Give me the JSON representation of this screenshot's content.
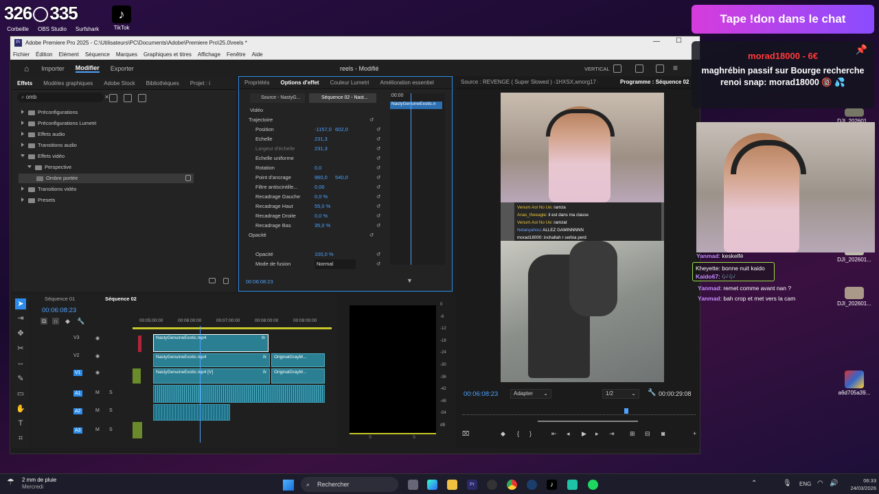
{
  "desktop": {
    "icons": [
      {
        "label": "Corbeille",
        "title_text": "326"
      },
      {
        "label": "OBS Studio",
        "title_text": "335"
      },
      {
        "label": "Surfshark",
        "title_text": ""
      },
      {
        "label": "TikTok",
        "title_text": ""
      }
    ],
    "right_icons": [
      {
        "label": "DJI_202601..."
      },
      {
        "label": "DJI_202601..."
      },
      {
        "label": "DJI_202601..."
      },
      {
        "label": "a6d705a39..."
      }
    ]
  },
  "premiere": {
    "window_title": "Adobe Premiere Pro 2025 - C:\\Utilisateurs\\PC\\Documents\\Adobe\\Premiere Pro\\25.0\\reels *",
    "menu": [
      "Fichier",
      "Édition",
      "Elément",
      "Séquence",
      "Marques",
      "Graphiques et titres",
      "Affichage",
      "Fenêtre",
      "Aide"
    ],
    "workspace_tabs": [
      "Importer",
      "Modifier",
      "Exporter"
    ],
    "active_workspace": "Modifier",
    "project_title": "reels - Modifié",
    "layout_label": "VERTICAL",
    "effects_panel": {
      "tabs": [
        "Effets",
        "Modèles graphiques",
        "Adobe Stock",
        "Bibliothèques",
        "Projet : i"
      ],
      "search_value": "omb",
      "tree": [
        {
          "label": "Préconfigurations",
          "level": 0
        },
        {
          "label": "Préconfigurations Lumetri",
          "level": 0
        },
        {
          "label": "Effets audio",
          "level": 0
        },
        {
          "label": "Transitions audio",
          "level": 0
        },
        {
          "label": "Effets vidéo",
          "level": 0
        },
        {
          "label": "Perspective",
          "level": 1
        },
        {
          "label": "Ombre portée",
          "level": 2
        },
        {
          "label": "Transitions vidéo",
          "level": 0
        },
        {
          "label": "Presets",
          "level": 0
        }
      ]
    },
    "effect_controls": {
      "tabs": [
        "Propriétés",
        "Options d'effet",
        "Couleur Lumetri",
        "Amélioration essentiel"
      ],
      "source_tab": "Source - NastyG...",
      "sequence_tab": "Séquence 02 - Nast...",
      "timecode_top": ":00:00",
      "clip_label": "NastyGenuineExotic.n",
      "section_video": "Vidéo",
      "properties": [
        {
          "name": "Trajectoire",
          "value": "",
          "value2": ""
        },
        {
          "name": "Position",
          "value": "-1157,0",
          "value2": "602,0"
        },
        {
          "name": "Echelle",
          "value": "231,3",
          "value2": ""
        },
        {
          "name": "Largeur d'échelle",
          "value": "231,3",
          "value2": ""
        },
        {
          "name": "Echelle uniforme",
          "value": "",
          "value2": ""
        },
        {
          "name": "Rotation",
          "value": "0,0",
          "value2": ""
        },
        {
          "name": "Point d'ancrage",
          "value": "960,0",
          "value2": "540,0"
        },
        {
          "name": "Filtre antiscintille...",
          "value": "0,00",
          "value2": ""
        },
        {
          "name": "Recadrage Gauche",
          "value": "0,0 %",
          "value2": ""
        },
        {
          "name": "Recadrage Haut",
          "value": "55,0 %",
          "value2": ""
        },
        {
          "name": "Recadrage Droite",
          "value": "0,0 %",
          "value2": ""
        },
        {
          "name": "Recadrage Bas",
          "value": "35,0 %",
          "value2": ""
        },
        {
          "name": "Opacité",
          "value": "",
          "value2": ""
        },
        {
          "name": "Opacité",
          "value": "100,0 %",
          "value2": ""
        },
        {
          "name": "Mode de fusion",
          "value": "Normal",
          "value2": ""
        }
      ],
      "timecode_bottom": "00:06:08:23"
    },
    "source_monitor_label": "Source : REVENGE ( Super Slowed ) -1HXSX,wnorg17 (1).mp4",
    "program_label": "Programme : Séquence 02",
    "program": {
      "timecode": "00:06:08:23",
      "fit": "Adapter",
      "resolution": "1/2",
      "duration": "00:00:29:08",
      "chat_lines": [
        {
          "user": "Venum Aoi No Ue",
          "text": "ramza"
        },
        {
          "user": "Anas_theeagle",
          "text": "il est dans ma classe"
        },
        {
          "user": "Venum Aoi No Ue",
          "text": "ramzat"
        },
        {
          "user": "Netanyahou",
          "text": "ALLEZ GAMINNNNN"
        },
        {
          "user": "morad18000",
          "text": "inchallah r serbia perd"
        }
      ]
    },
    "timeline": {
      "tabs": [
        "Séquence 01",
        "Séquence 02"
      ],
      "timecode": "00:06:08:23",
      "ruler": [
        "00:05:00:00",
        "00:06:00:00",
        "00:07:00:00",
        "00:08:00:00",
        "00:09:00:00"
      ],
      "video_tracks": [
        "V3",
        "V2",
        "V1"
      ],
      "audio_tracks": [
        "A1",
        "A2",
        "A3"
      ],
      "clips": [
        {
          "name": "NastyGenuineExotic.mp4",
          "track": "V3"
        },
        {
          "name": "NastyGenuineExotic.mp4",
          "track": "V2"
        },
        {
          "name": "OriginalGrayM...",
          "track": "V2"
        },
        {
          "name": "NastyGenuineExotic.mp4 [V]",
          "track": "V1"
        },
        {
          "name": "OriginalGrayM...",
          "track": "V1"
        }
      ]
    },
    "audio_meter": {
      "scale": [
        "0",
        "-6",
        "-12",
        "-18",
        "-24",
        "-30",
        "-36",
        "-42",
        "-48",
        "-54",
        "dB"
      ],
      "channels": [
        "S",
        "S"
      ]
    }
  },
  "overlay": {
    "banner": "Tape !don dans le chat",
    "donation_title": "morad18000 - 6€",
    "donation_message": "maghrébin passif sur Bourge recherche renoi snap: morad18000 🔞 💦",
    "chat": [
      {
        "user": "Yanmad",
        "text": "keskelfé"
      },
      {
        "user": "Kheyette",
        "text": "bonne nuit kaido"
      },
      {
        "user": "Kaido67",
        "text": "🎶🎶"
      },
      {
        "user": "Yanmad",
        "text": "remet comme avant nan ?"
      },
      {
        "user": "Yanmad",
        "text": "bah crop et met vers la cam"
      }
    ]
  },
  "taskbar": {
    "weather": "2 mm de pluie",
    "weather_sub": "Mercredi",
    "search_placeholder": "Rechercher",
    "language": "ENG",
    "time": "06:33",
    "date": "24/03/2026"
  },
  "colors": {
    "accent": "#4ea3ff",
    "selection": "#2d8ceb",
    "clip": "#2b7f93"
  }
}
